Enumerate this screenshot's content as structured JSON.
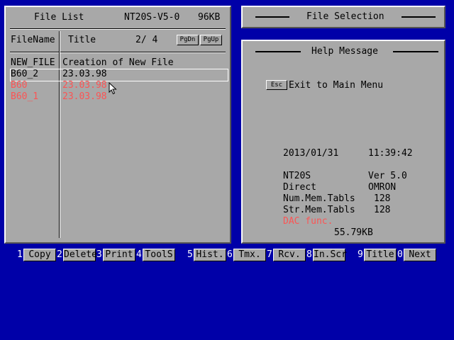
{
  "file_list": {
    "title": "File List",
    "model": "NT20S-V5-0",
    "size": "96KB",
    "col_filename": "FileName",
    "col_title": "Title",
    "page": "2/ 4",
    "pgdn_label": "PgDn",
    "pgup_label": "PgUp",
    "rows": [
      {
        "name": "NEW_FILE",
        "title": "Creation of New File",
        "color": "#000000"
      },
      {
        "name": "B60_2",
        "title": "23.03.98",
        "color": "#000000"
      },
      {
        "name": "B60",
        "title": "23.03.98",
        "color": "#fc5454"
      },
      {
        "name": "B60_1",
        "title": "23.03.98",
        "color": "#fc5454"
      }
    ]
  },
  "file_selection": {
    "title": "File Selection"
  },
  "help": {
    "title": "Help Message",
    "esc_key": "Esc",
    "esc_text": "Exit to Main Menu",
    "date": "2013/01/31",
    "time": "11:39:42",
    "model": "NT20S",
    "version": "Ver 5.0",
    "mode": "Direct",
    "vendor": "OMRON",
    "num_label": "Num.Mem.Tabls",
    "num_value": "128",
    "str_label": "Str.Mem.Tabls",
    "str_value": "128",
    "dac": "DAC func.",
    "free": "55.79KB"
  },
  "fkeys": [
    {
      "num": "1",
      "label": "Copy"
    },
    {
      "num": "2",
      "label": "Delete"
    },
    {
      "num": "3",
      "label": "Print"
    },
    {
      "num": "4",
      "label": "ToolS"
    },
    {
      "num": "5",
      "label": "Hist."
    },
    {
      "num": "6",
      "label": "Tmx."
    },
    {
      "num": "7",
      "label": "Rcv."
    },
    {
      "num": "8",
      "label": "In.Scr"
    },
    {
      "num": "9",
      "label": "Title"
    },
    {
      "num": "0",
      "label": "Next"
    }
  ],
  "colors": {
    "background": "#0000a8",
    "panel": "#a8a8a8",
    "highlight": "#fc5454"
  }
}
